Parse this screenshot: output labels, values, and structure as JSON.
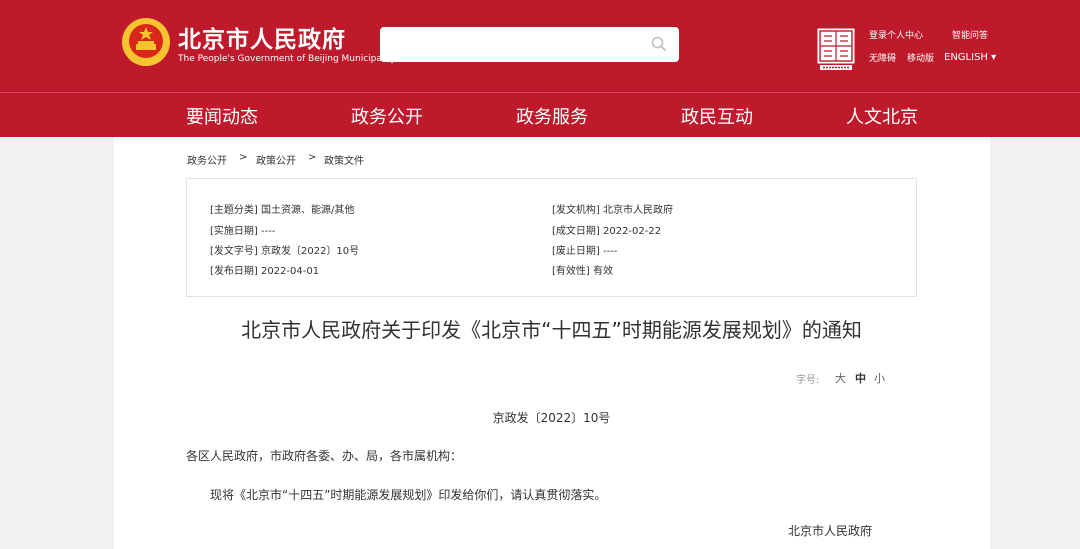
{
  "header": {
    "site_name_cn": "北京市人民政府",
    "site_name_en": "The People's Government of Beijing Municipality",
    "search_placeholder": "",
    "utility": {
      "login": "登录个人中心",
      "help": "智能问答",
      "accessibility": "无障碍",
      "mobile": "移动版",
      "language": "ENGLISH ▾"
    }
  },
  "nav": {
    "items": [
      "要闻动态",
      "政务公开",
      "政务服务",
      "政民互动",
      "人文北京"
    ]
  },
  "breadcrumb": [
    "政务公开",
    "政策公开",
    "政策文件"
  ],
  "breadcrumb_sep": ">",
  "meta": {
    "topic": "[主题分类] 国土资源、能源/其他",
    "issuer": "[发文机构] 北京市人民政府",
    "effective_date": "[实施日期] ----",
    "created_date": "[成文日期] 2022-02-22",
    "doc_number": "[发文字号] 京政发〔2022〕10号",
    "abolished_date": "[废止日期] ----",
    "published_date": "[发布日期] 2022-04-01",
    "validity": "[有效性] 有效"
  },
  "document": {
    "title": "北京市人民政府关于印发《北京市“十四五”时期能源发展规划》的通知",
    "font_size_label": "字号:",
    "font_sizes": [
      "大",
      "中",
      "小"
    ],
    "doc_no": "京政发〔2022〕10号",
    "salutation": "各区人民政府，市政府各委、办、局，各市属机构：",
    "body": "现将《北京市“十四五”时期能源发展规划》印发给你们，请认真贯彻落实。",
    "signature": "北京市人民政府"
  },
  "colors": {
    "brand_red": "#bf1a2b",
    "gold": "#f6c431"
  }
}
